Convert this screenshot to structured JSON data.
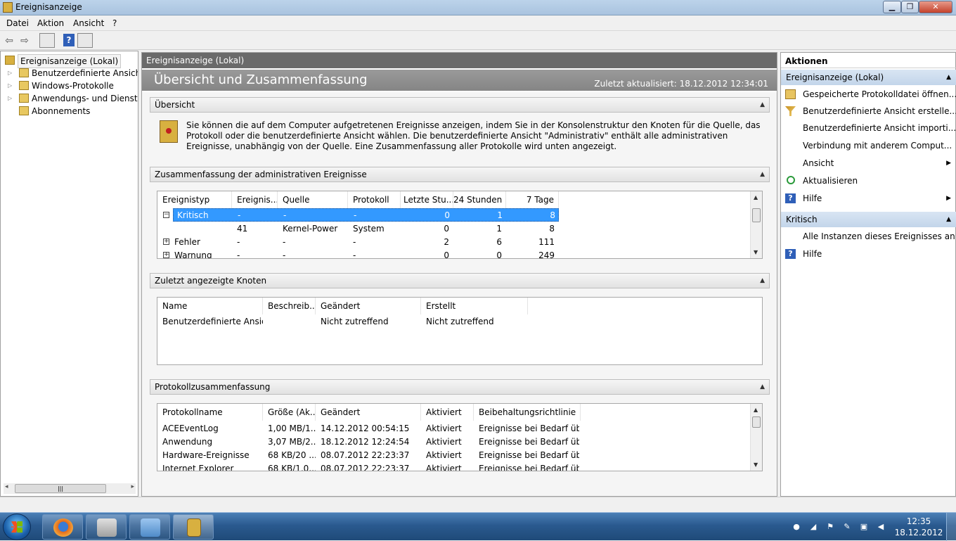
{
  "window": {
    "title": "Ereignisanzeige"
  },
  "menu": [
    "Datei",
    "Aktion",
    "Ansicht",
    "?"
  ],
  "tree": {
    "root": "Ereignisanzeige (Lokal)",
    "items": [
      "Benutzerdefinierte Ansichten",
      "Windows-Protokolle",
      "Anwendungs- und Dienstprotokolle",
      "Abonnements"
    ]
  },
  "center": {
    "header": "Ereignisanzeige (Lokal)",
    "banner_title": "Übersicht und Zusammenfassung",
    "last_updated": "Zuletzt aktualisiert: 18.12.2012 12:34:01",
    "overview": {
      "title": "Übersicht",
      "text": "Sie können die auf dem Computer aufgetretenen Ereignisse anzeigen, indem Sie in der Konsolenstruktur den Knoten für die Quelle, das Protokoll oder die benutzerdefinierte Ansicht wählen. Die benutzerdefinierte Ansicht \"Administrativ\" enthält alle administrativen Ereignisse, unabhängig von der Quelle. Eine Zusammenfassung aller Protokolle wird unten angezeigt."
    },
    "admin_summary": {
      "title": "Zusammenfassung der administrativen Ereignisse",
      "columns": [
        "Ereignistyp",
        "Ereignis...",
        "Quelle",
        "Protokoll",
        "Letzte Stu...",
        "24 Stunden",
        "7 Tage"
      ],
      "rows": [
        [
          "Kritisch",
          "-",
          "-",
          "-",
          "0",
          "1",
          "8"
        ],
        [
          "",
          "41",
          "Kernel-Power",
          "System",
          "0",
          "1",
          "8"
        ],
        [
          "Fehler",
          "-",
          "-",
          "-",
          "2",
          "6",
          "111"
        ],
        [
          "Warnung",
          "-",
          "-",
          "-",
          "0",
          "0",
          "249"
        ]
      ]
    },
    "recent_nodes": {
      "title": "Zuletzt angezeigte Knoten",
      "columns": [
        "Name",
        "Beschreib...",
        "Geändert",
        "Erstellt"
      ],
      "rows": [
        [
          "Benutzerdefinierte Ansic...",
          "",
          "Nicht zutreffend",
          "Nicht zutreffend"
        ]
      ]
    },
    "log_summary": {
      "title": "Protokollzusammenfassung",
      "columns": [
        "Protokollname",
        "Größe (Ak...",
        "Geändert",
        "Aktiviert",
        "Beibehaltungsrichtlinie"
      ],
      "rows": [
        [
          "ACEEventLog",
          "1,00 MB/1...",
          "14.12.2012 00:54:15",
          "Aktiviert",
          "Ereignisse bei Bedarf üb..."
        ],
        [
          "Anwendung",
          "3,07 MB/2...",
          "18.12.2012 12:24:54",
          "Aktiviert",
          "Ereignisse bei Bedarf üb..."
        ],
        [
          "Hardware-Ereignisse",
          "68 KB/20 ...",
          "08.07.2012 22:23:37",
          "Aktiviert",
          "Ereignisse bei Bedarf üb..."
        ],
        [
          "Internet Explorer",
          "68 KB/1,0...",
          "08.07.2012 22:23:37",
          "Aktiviert",
          "Ereignisse bei Bedarf üb..."
        ]
      ]
    }
  },
  "actions": {
    "title": "Aktionen",
    "group1": "Ereignisanzeige (Lokal)",
    "items1": [
      "Gespeicherte Protokolldatei öffnen...",
      "Benutzerdefinierte Ansicht erstelle...",
      "Benutzerdefinierte Ansicht importi...",
      "Verbindung mit anderem Comput...",
      "Ansicht",
      "Aktualisieren",
      "Hilfe"
    ],
    "group2": "Kritisch",
    "items2": [
      "Alle Instanzen dieses Ereignisses an...",
      "Hilfe"
    ]
  },
  "taskbar": {
    "time": "12:35",
    "date": "18.12.2012"
  }
}
